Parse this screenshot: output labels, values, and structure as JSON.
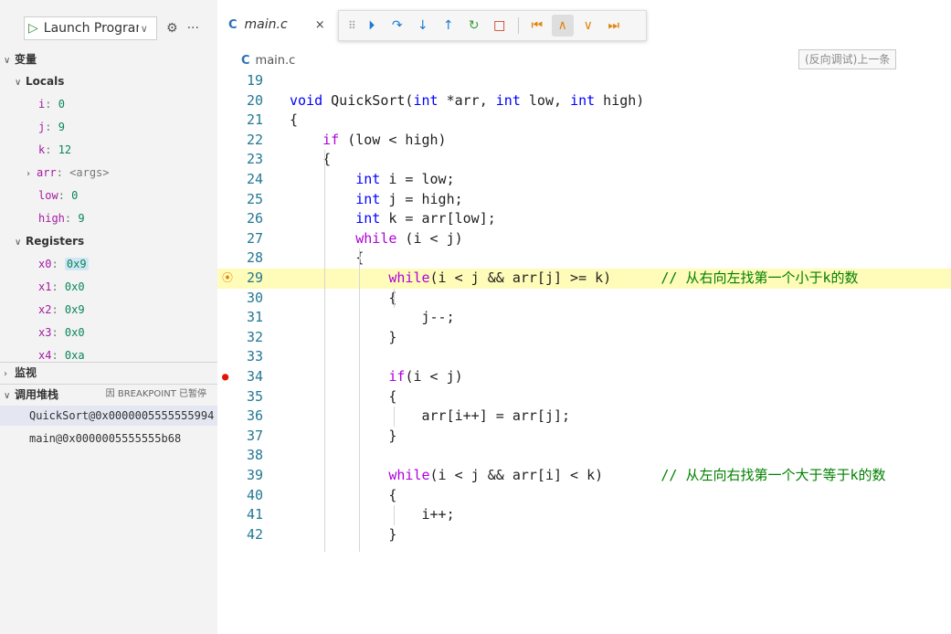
{
  "launch": {
    "label": "Launch Program",
    "play_icon": "play-icon",
    "settings_icon": "gear-icon",
    "more_label": "···"
  },
  "variables": {
    "title": "变量",
    "locals": {
      "title": "Locals",
      "items": [
        {
          "name": "i",
          "value": "0"
        },
        {
          "name": "j",
          "value": "9"
        },
        {
          "name": "k",
          "value": "12"
        },
        {
          "name": "arr",
          "value": "<args>"
        },
        {
          "name": "low",
          "value": "0"
        },
        {
          "name": "high",
          "value": "9"
        }
      ]
    },
    "registers": {
      "title": "Registers",
      "items": [
        {
          "name": "x0",
          "value": "0x9"
        },
        {
          "name": "x1",
          "value": "0x0"
        },
        {
          "name": "x2",
          "value": "0x9"
        },
        {
          "name": "x3",
          "value": "0x0"
        },
        {
          "name": "x4",
          "value": "0xa"
        }
      ]
    }
  },
  "watch": {
    "title": "监视"
  },
  "callstack": {
    "title": "调用堆栈",
    "badge": "因 BREAKPOINT 已暂停",
    "frames": [
      {
        "label": "QuickSort@0x0000005555555994"
      },
      {
        "label": "main@0x0000005555555b68"
      }
    ]
  },
  "tab": {
    "icon_label": "C",
    "title": "main.c",
    "close_label": "×"
  },
  "breadcrumb": {
    "icon_label": "C",
    "file": "main.c"
  },
  "tooltip": "(反向调试)上一条",
  "debug_toolbar": {
    "buttons": [
      {
        "name": "continue",
        "glyph": "⏵"
      },
      {
        "name": "step-over",
        "glyph": "↷"
      },
      {
        "name": "step-into",
        "glyph": "⤓"
      },
      {
        "name": "step-out",
        "glyph": "↑"
      },
      {
        "name": "restart",
        "glyph": "↻"
      },
      {
        "name": "stop",
        "glyph": "□"
      },
      {
        "name": "reverse-continue",
        "glyph": "⏮"
      },
      {
        "name": "step-back",
        "glyph": "∧"
      },
      {
        "name": "step-forward",
        "glyph": "∨"
      },
      {
        "name": "continue-forward",
        "glyph": "⏭"
      }
    ]
  },
  "code": {
    "current_line": 29,
    "breakpoint_line": 34,
    "lines": [
      {
        "n": "19",
        "t": ""
      },
      {
        "n": "20",
        "t": "void QuickSort(int *arr, int low, int high)"
      },
      {
        "n": "21",
        "t": "{"
      },
      {
        "n": "22",
        "t": "    if (low < high)"
      },
      {
        "n": "23",
        "t": "    {"
      },
      {
        "n": "24",
        "t": "        int i = low;"
      },
      {
        "n": "25",
        "t": "        int j = high;"
      },
      {
        "n": "26",
        "t": "        int k = arr[low];"
      },
      {
        "n": "27",
        "t": "        while (i < j)"
      },
      {
        "n": "28",
        "t": "        {"
      },
      {
        "n": "29",
        "t": "            while(i < j && arr[j] >= k)      // 从右向左找第一个小于k的数"
      },
      {
        "n": "30",
        "t": "            {"
      },
      {
        "n": "31",
        "t": "                j--;"
      },
      {
        "n": "32",
        "t": "            }"
      },
      {
        "n": "33",
        "t": ""
      },
      {
        "n": "34",
        "t": "            if(i < j)"
      },
      {
        "n": "35",
        "t": "            {"
      },
      {
        "n": "36",
        "t": "                arr[i++] = arr[j];"
      },
      {
        "n": "37",
        "t": "            }"
      },
      {
        "n": "38",
        "t": ""
      },
      {
        "n": "39",
        "t": "            while(i < j && arr[i] < k)       // 从左向右找第一个大于等于k的数"
      },
      {
        "n": "40",
        "t": "            {"
      },
      {
        "n": "41",
        "t": "                i++;"
      },
      {
        "n": "42",
        "t": "            }"
      }
    ]
  }
}
